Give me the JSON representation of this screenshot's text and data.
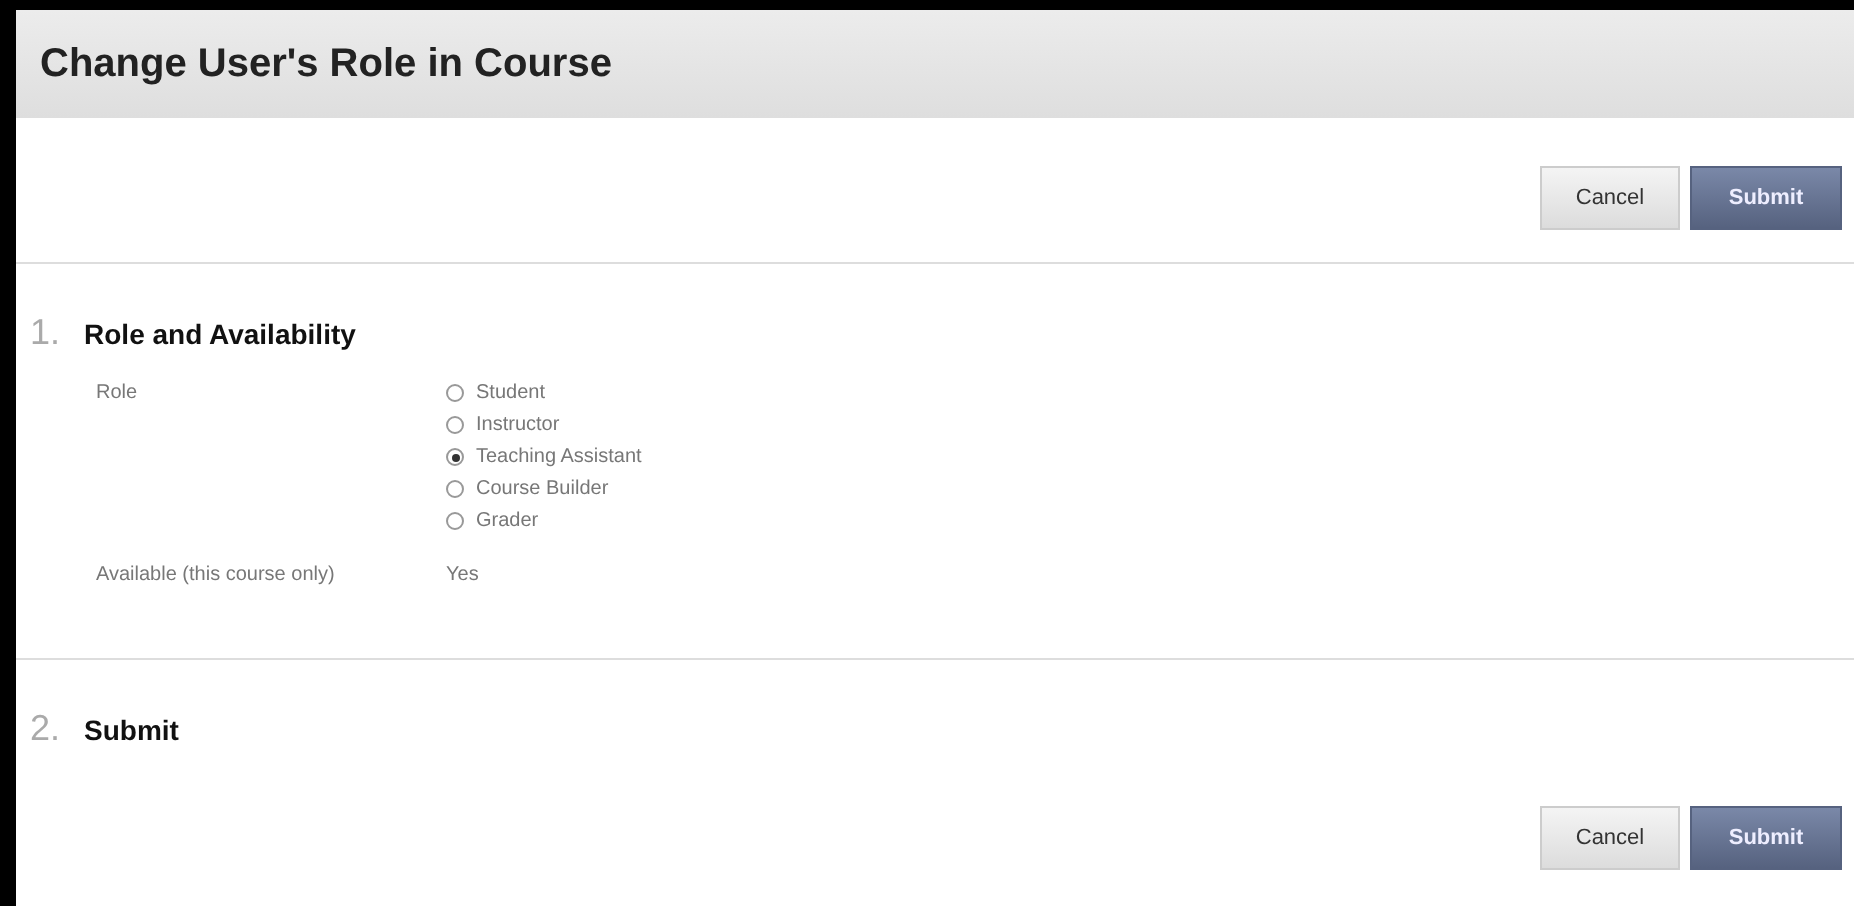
{
  "window": {
    "title": "Change User's Role in Course"
  },
  "top_buttons": [
    {
      "label": "Cancel",
      "kind": "secondary"
    },
    {
      "label": "Submit",
      "kind": "primary"
    }
  ],
  "sections": [
    {
      "number": "1.",
      "title": "Role and Availability",
      "fields": [
        {
          "kind": "radio",
          "label": "Role",
          "options": [
            {
              "label": "Student",
              "selected": false
            },
            {
              "label": "Instructor",
              "selected": false
            },
            {
              "label": "Teaching Assistant",
              "selected": true
            },
            {
              "label": "Course Builder",
              "selected": false
            },
            {
              "label": "Grader",
              "selected": false
            }
          ]
        },
        {
          "kind": "text",
          "label": "Available (this course only)",
          "value": "Yes"
        }
      ]
    },
    {
      "number": "2.",
      "title": "Submit",
      "buttons": [
        {
          "label": "Cancel",
          "kind": "secondary"
        },
        {
          "label": "Submit",
          "kind": "primary"
        }
      ]
    }
  ]
}
